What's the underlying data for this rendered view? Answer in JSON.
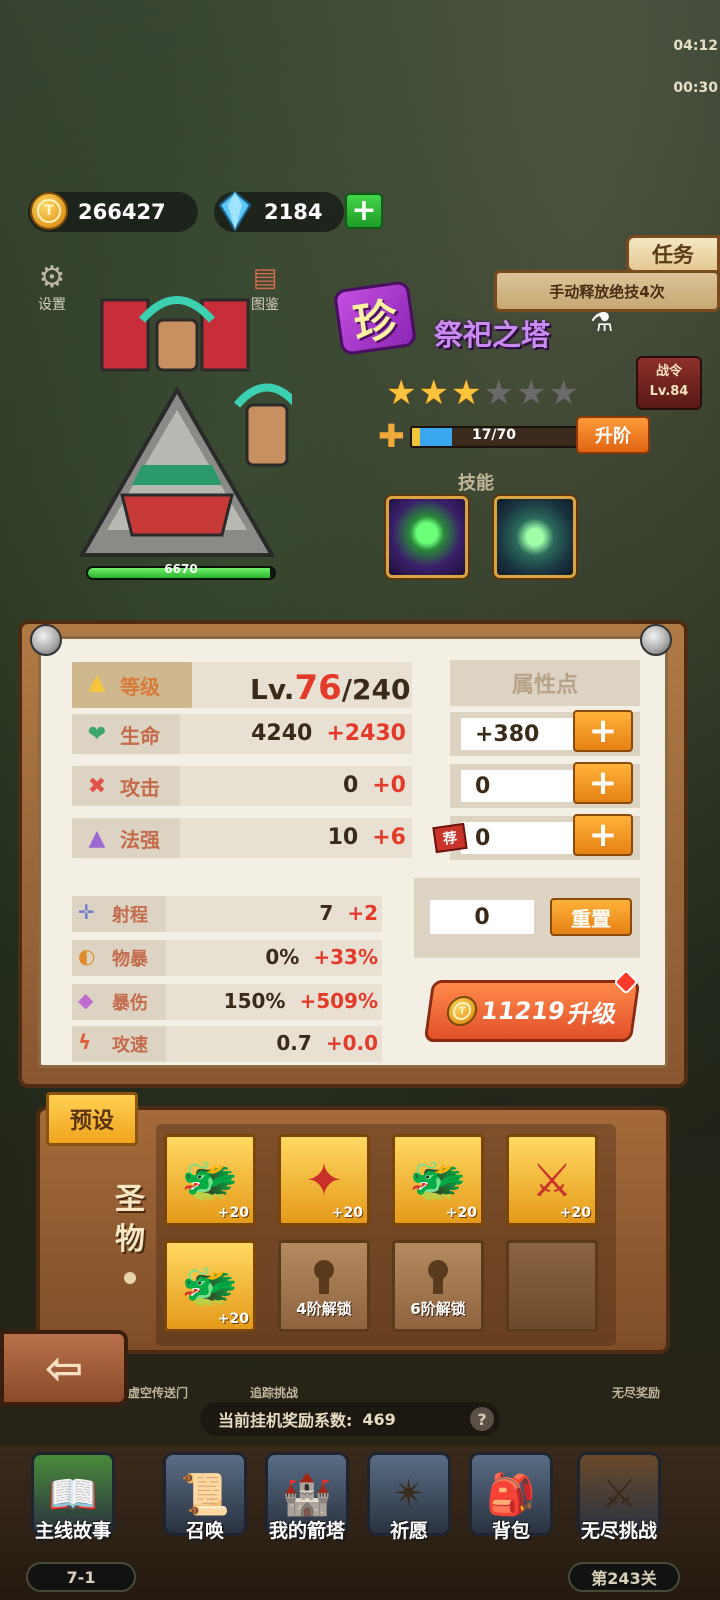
{
  "resources": {
    "gold": "266427",
    "gems": "2184"
  },
  "top_right": {
    "time1": "04:12",
    "time2": "00:30"
  },
  "left_menu": {
    "settings": "设置",
    "item2": "图鉴"
  },
  "right_panel": {
    "task_button": "任务",
    "task_text": "手动释放绝技4次",
    "battle_pass_label": "战令",
    "battle_pass_level": "Lv.84"
  },
  "hero": {
    "rarity": "珍",
    "name": "祭祀之塔",
    "stars_filled": 3,
    "stars_total": 6,
    "shards": "17/70",
    "shard_fraction": 0.243,
    "upgrade_rank_label": "升阶",
    "hp_value": "6670",
    "hp_fraction": 0.98,
    "skills_title": "技能",
    "skills": [
      "green-flame-skill",
      "spirit-mask-skill"
    ]
  },
  "stats": {
    "level_label": "等级",
    "level_prefix": "Lv.",
    "level_current": "76",
    "level_max": "/240",
    "attr_points_label": "属性点",
    "rows": [
      {
        "name": "生命",
        "icon": "heart-icon",
        "base": "4240",
        "bonus": "+2430",
        "points": "+380"
      },
      {
        "name": "攻击",
        "icon": "sword-icon",
        "base": "0",
        "bonus": "+0",
        "points": "0"
      },
      {
        "name": "法强",
        "icon": "wizard-hat-icon",
        "base": "10",
        "bonus": "+6",
        "points": "0"
      }
    ],
    "recommend_tag": "荐",
    "sub_rows": [
      {
        "name": "射程",
        "icon": "crosshair-icon",
        "base": "7",
        "bonus": "+2"
      },
      {
        "name": "物暴",
        "icon": "crit-icon",
        "base": "0%",
        "bonus": "+33%"
      },
      {
        "name": "暴伤",
        "icon": "crystal-icon",
        "base": "150%",
        "bonus": "+509%"
      },
      {
        "name": "攻速",
        "icon": "lightning-icon",
        "base": "0.7",
        "bonus": "+0.0"
      }
    ],
    "reset_value": "0",
    "reset_label": "重置",
    "level_up_cost": "11219",
    "level_up_label": "升级"
  },
  "relics": {
    "preset_label": "预设",
    "title_top": "圣",
    "title_bottom": "物",
    "slots": [
      {
        "icon": "dragon-mask-icon",
        "level": "+20"
      },
      {
        "icon": "golden-star-icon",
        "level": "+20"
      },
      {
        "icon": "dragon-mask-icon",
        "level": "+20"
      },
      {
        "icon": "sword-anvil-icon",
        "level": "+20"
      },
      {
        "icon": "dragon-mask-icon",
        "level": "+20"
      }
    ],
    "locked": [
      "4阶解锁",
      "6阶解锁"
    ]
  },
  "bottom": {
    "portal_label": "虚空传送门",
    "challenge_label": "追踪挑战",
    "endless_reward_label": "无尽奖励",
    "idle_label": "当前挂机奖励系数:",
    "idle_value": "469",
    "help": "?",
    "nav": [
      {
        "label": "主线故事",
        "icon": "book-icon",
        "sub": "7-1"
      },
      {
        "label": "召唤",
        "icon": "scroll-icon"
      },
      {
        "label": "我的箭塔",
        "icon": "tower-icon"
      },
      {
        "label": "祈愿",
        "icon": "star-icon"
      },
      {
        "label": "背包",
        "icon": "backpack-icon"
      },
      {
        "label": "无尽挑战",
        "icon": "sword-shield-icon",
        "sub": "第243关"
      }
    ]
  }
}
